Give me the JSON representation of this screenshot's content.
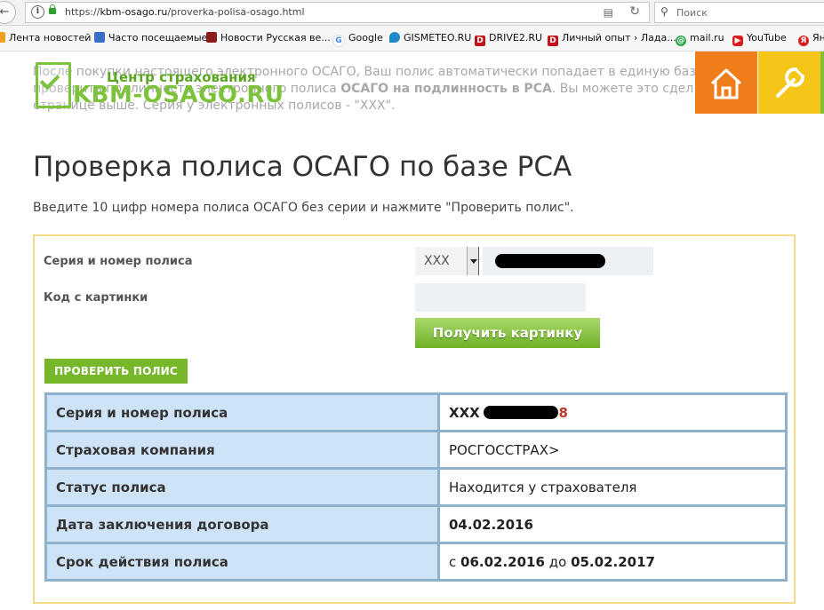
{
  "browser": {
    "url_prefix": "https://",
    "url_host": "kbm-osago.ru",
    "url_path": "/proverka-polisa-osago.html",
    "search_placeholder": "Поиск"
  },
  "bookmarks": [
    {
      "label": "Лента новостей",
      "icon": "rss-icon",
      "color": "#f0a020"
    },
    {
      "label": "Часто посещаемые",
      "icon": "search-page-icon",
      "color": "#3a6fc4"
    },
    {
      "label": "Новости  Русская ве...",
      "icon": "news-icon",
      "color": "#8a1c1c"
    },
    {
      "label": "Google",
      "icon": "google-icon",
      "color": "#4285f4"
    },
    {
      "label": "GISMETEO.RU",
      "icon": "drop-icon",
      "color": "#1e88c8"
    },
    {
      "label": "DRIVE2.RU",
      "icon": "d-icon",
      "color": "#c0141c"
    },
    {
      "label": "Личный опыт › Лада...",
      "icon": "d-icon",
      "color": "#c0141c"
    },
    {
      "label": "mail.ru",
      "icon": "mailru-icon",
      "color": "#2aa64c"
    },
    {
      "label": "YouTube",
      "icon": "youtube-icon",
      "color": "#d61e1e"
    },
    {
      "label": "Ян",
      "icon": "yandex-icon",
      "color": "#d61e1e"
    }
  ],
  "page": {
    "faded_intro_1": "После покупки настоящего электронного ОСАГО, Ваш полис автоматически попадает в единую базу.",
    "faded_intro_2a": "проверить подлинность электронного полиса ",
    "faded_intro_2b": "ОСАГО на подлинность в РСА",
    "faded_intro_2c": ". Вы можете это сдел",
    "faded_intro_3": "странице выше. Серия у электронных полисов - \"ХХХ\".",
    "logo_tagline": "Центр страхования",
    "logo_brand": "KBM-OSAGO.RU",
    "title": "Проверка полиса ОСАГО по базе РСА",
    "instruction": "Введите 10 цифр номера полиса ОСАГО без серии и нажмите \"Проверить полис\"."
  },
  "form": {
    "series_label": "Серия и номер полиса",
    "captcha_label": "Код с картинки",
    "series_value": "XXX",
    "get_image_button": "Получить картинку",
    "check_button": "ПРОВЕРИТЬ ПОЛИС"
  },
  "result": {
    "rows": [
      {
        "key": "Серия и номер полиса",
        "value": "XXX",
        "value_suffix": "8"
      },
      {
        "key": "Страховая компания",
        "value": "РОСГОССТРАХ>"
      },
      {
        "key": "Статус полиса",
        "value": "Находится у страхователя"
      },
      {
        "key": "Дата заключения договора",
        "value": "04.02.2016"
      },
      {
        "key": "Срок действия полиса",
        "from_word": "с",
        "from": "06.02.2016",
        "to_word": "до",
        "to": "05.02.2017"
      }
    ]
  },
  "colors": {
    "accent_green": "#77b82a",
    "tile_orange": "#ef7d1a",
    "tile_yellow": "#f5c518",
    "table_key_bg": "#cfe3f6",
    "table_border": "#8fb2cc",
    "box_border": "#f2dc8c"
  }
}
